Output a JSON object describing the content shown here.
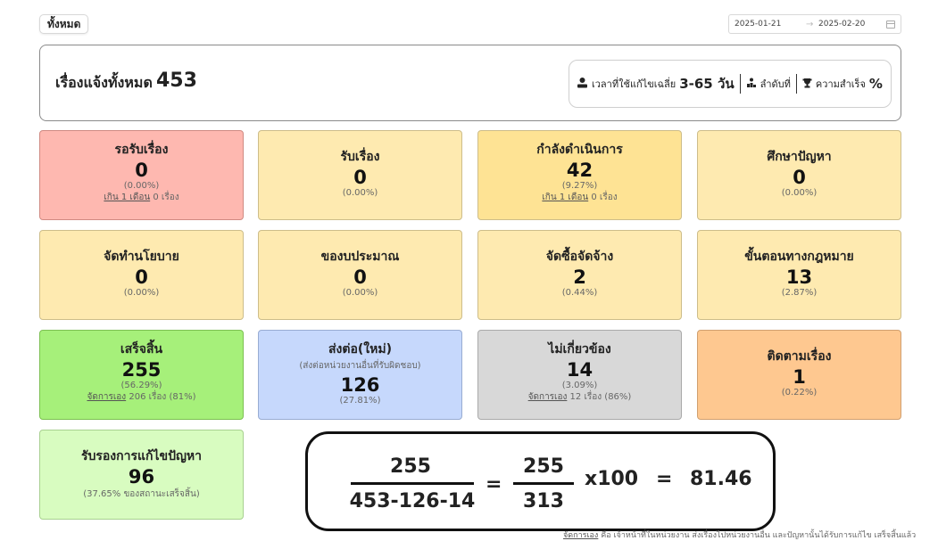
{
  "filter": {
    "label": "ทั้งหมด"
  },
  "date_range": {
    "start": "2025-01-21",
    "arrow": "→",
    "end": "2025-02-20"
  },
  "summary": {
    "title": "เรื่องแจ้งทั้งหมด",
    "total": "453",
    "avg_time_label": "เวลาที่ใช้แก้ไขเฉลี่ย",
    "avg_time_value": "3-65 วัน",
    "rank_label": "ลำดับที่",
    "success_label": "ความสำเร็จ",
    "success_value": "%"
  },
  "cards": [
    {
      "title": "รอรับเรื่อง",
      "value": "0",
      "percent": "(0.00%)",
      "sub_link": "เกิน 1 เดือน",
      "sub_rest": " 0 เรื่อง",
      "color": "#feb8b0"
    },
    {
      "title": "รับเรื่อง",
      "value": "0",
      "percent": "(0.00%)",
      "color": "#feeab0"
    },
    {
      "title": "กำลังดำเนินการ",
      "value": "42",
      "percent": "(9.27%)",
      "sub_link": "เกิน 1 เดือน",
      "sub_rest": " 0 เรื่อง",
      "color": "#fee394"
    },
    {
      "title": "ศึกษาปัญหา",
      "value": "0",
      "percent": "(0.00%)",
      "color": "#feeab0"
    },
    {
      "title": "จัดทำนโยบาย",
      "value": "0",
      "percent": "(0.00%)",
      "color": "#feeab0"
    },
    {
      "title": "ของบประมาณ",
      "value": "0",
      "percent": "(0.00%)",
      "color": "#feeab0"
    },
    {
      "title": "จัดซื้อจัดจ้าง",
      "value": "2",
      "percent": "(0.44%)",
      "color": "#feeab0"
    },
    {
      "title": "ขั้นตอนทางกฎหมาย",
      "value": "13",
      "percent": "(2.87%)",
      "color": "#feeab0"
    },
    {
      "title": "เสร็จสิ้น",
      "value": "255",
      "percent": "(56.29%)",
      "sub_link": "จัดการเอง",
      "sub_rest": " 206 เรื่อง (81%)",
      "color": "#a6f07a"
    },
    {
      "title": "ส่งต่อ(ใหม่)",
      "note": "(ส่งต่อหน่วยงานอื่นที่รับผิดชอบ)",
      "value": "126",
      "percent": "(27.81%)",
      "color": "#c6d8fc"
    },
    {
      "title": "ไม่เกี่ยวข้อง",
      "value": "14",
      "percent": "(3.09%)",
      "sub_link": "จัดการเอง",
      "sub_rest": " 12 เรื่อง (86%)",
      "color": "#d8d8d8"
    },
    {
      "title": "ติดตามเรื่อง",
      "value": "1",
      "percent": "(0.22%)",
      "color": "#fec890"
    },
    {
      "title": "รับรองการแก้ไขปัญหา",
      "value": "96",
      "percent": "(37.65% ของสถานะเสร็จสิ้น)",
      "color": "#d8fcc0"
    }
  ],
  "formula": {
    "num1": "255",
    "den1": "453-126-14",
    "eq1": "=",
    "num2": "255",
    "den2": "313",
    "mult": "x100",
    "eq2": "=",
    "result": "81.46"
  },
  "footnote": {
    "link": "จัดการเอง",
    "text": " คือ เจ้าหน้าที่ในหน่วยงาน ส่งเรื่องไปหน่วยงานอื่น และปัญหานั้นได้รับการแก้ไข เสร็จสิ้นแล้ว"
  }
}
